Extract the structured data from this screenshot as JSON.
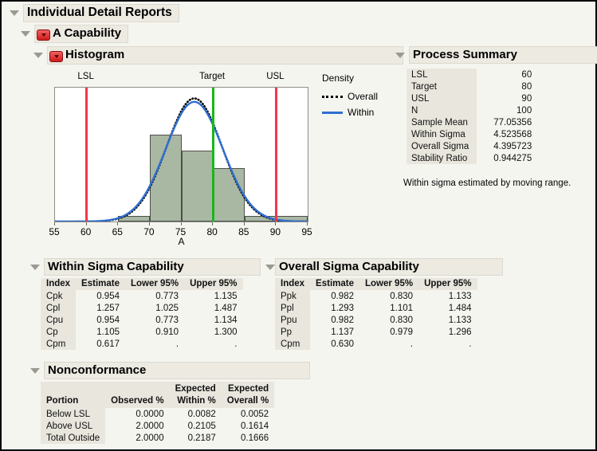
{
  "report": {
    "title": "Individual Detail Reports",
    "capability_title": "A Capability",
    "histogram_title": "Histogram",
    "process_summary_title": "Process Summary",
    "process_summary_note": "Within sigma estimated by moving range."
  },
  "process_summary": {
    "rows": [
      {
        "label": "LSL",
        "value": "60"
      },
      {
        "label": "Target",
        "value": "80"
      },
      {
        "label": "USL",
        "value": "90"
      },
      {
        "label": "N",
        "value": "100"
      },
      {
        "label": "Sample Mean",
        "value": "77.05356"
      },
      {
        "label": "Within Sigma",
        "value": "4.523568"
      },
      {
        "label": "Overall Sigma",
        "value": "4.395723"
      },
      {
        "label": "Stability Ratio",
        "value": "0.944275"
      }
    ]
  },
  "chart_data": {
    "type": "bar",
    "title": "Histogram",
    "xlabel": "A",
    "ylabel": "Density",
    "xlim": [
      55,
      95
    ],
    "xticks": [
      55,
      60,
      65,
      70,
      75,
      80,
      85,
      90,
      95
    ],
    "grid": false,
    "legend_title": "Density",
    "legend": [
      {
        "name": "Overall",
        "style": "dotted",
        "color": "#000000"
      },
      {
        "name": "Within",
        "style": "solid",
        "color": "#2f6fd0"
      }
    ],
    "bins": [
      {
        "from": 65,
        "to": 70,
        "height": 0.04
      },
      {
        "from": 70,
        "to": 75,
        "height": 0.65
      },
      {
        "from": 75,
        "to": 80,
        "height": 0.53
      },
      {
        "from": 80,
        "to": 85,
        "height": 0.4
      },
      {
        "from": 85,
        "to": 90,
        "height": 0.04
      },
      {
        "from": 90,
        "to": 95,
        "height": 0.04
      }
    ],
    "bar_color": "#a9b8a3",
    "reference_lines": [
      {
        "label": "LSL",
        "value": 60,
        "color": "#f4354c"
      },
      {
        "label": "Target",
        "value": 80,
        "color": "#18b818"
      },
      {
        "label": "USL",
        "value": 90,
        "color": "#f4354c"
      }
    ],
    "curves": [
      {
        "name": "Overall",
        "mean": 77.05356,
        "sigma": 4.395723,
        "style": "dotted",
        "color": "#000000"
      },
      {
        "name": "Within",
        "mean": 77.05356,
        "sigma": 4.523568,
        "style": "solid",
        "color": "#2f6fd0"
      }
    ]
  },
  "within_sigma": {
    "title": "Within Sigma Capability",
    "headers": [
      "Index",
      "Estimate",
      "Lower 95%",
      "Upper 95%"
    ],
    "rows": [
      [
        "Cpk",
        "0.954",
        "0.773",
        "1.135"
      ],
      [
        "Cpl",
        "1.257",
        "1.025",
        "1.487"
      ],
      [
        "Cpu",
        "0.954",
        "0.773",
        "1.134"
      ],
      [
        "Cp",
        "1.105",
        "0.910",
        "1.300"
      ],
      [
        "Cpm",
        "0.617",
        ".",
        "."
      ]
    ]
  },
  "overall_sigma": {
    "title": "Overall Sigma Capability",
    "headers": [
      "Index",
      "Estimate",
      "Lower 95%",
      "Upper 95%"
    ],
    "rows": [
      [
        "Ppk",
        "0.982",
        "0.830",
        "1.133"
      ],
      [
        "Ppl",
        "1.293",
        "1.101",
        "1.484"
      ],
      [
        "Ppu",
        "0.982",
        "0.830",
        "1.133"
      ],
      [
        "Pp",
        "1.137",
        "0.979",
        "1.296"
      ],
      [
        "Cpm",
        "0.630",
        ".",
        "."
      ]
    ]
  },
  "nonconformance": {
    "title": "Nonconformance",
    "headers": [
      "Portion",
      "Observed %",
      "Expected\nWithin %",
      "Expected\nOverall %"
    ],
    "headers_top": [
      "",
      "",
      "Expected",
      "Expected"
    ],
    "headers_bottom": [
      "Portion",
      "Observed %",
      "Within %",
      "Overall %"
    ],
    "rows": [
      [
        "Below LSL",
        "0.0000",
        "0.0082",
        "0.0052"
      ],
      [
        "Above USL",
        "2.0000",
        "0.2105",
        "0.1614"
      ],
      [
        "Total Outside",
        "2.0000",
        "0.2187",
        "0.1666"
      ]
    ]
  },
  "icons": {
    "disclosure": "triangle-down-icon",
    "red_menu": "red-triangle-menu-icon"
  }
}
